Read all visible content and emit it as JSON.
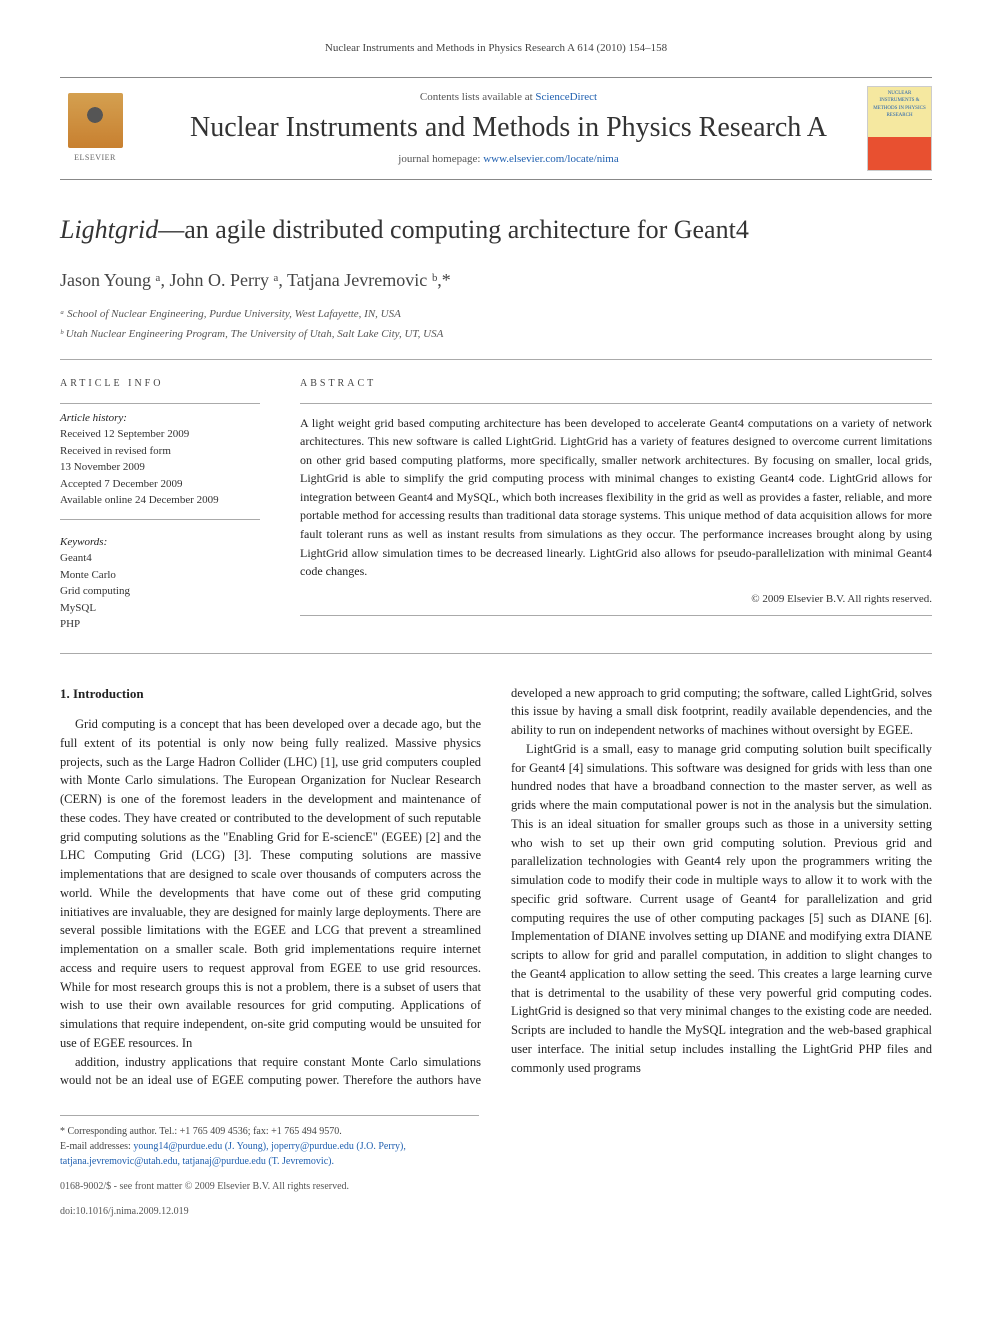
{
  "running_header": "Nuclear Instruments and Methods in Physics Research A 614 (2010) 154–158",
  "header": {
    "contents_prefix": "Contents lists available at ",
    "contents_link": "ScienceDirect",
    "journal_name": "Nuclear Instruments and Methods in Physics Research A",
    "homepage_prefix": "journal homepage: ",
    "homepage_link": "www.elsevier.com/locate/nima",
    "elsevier": "ELSEVIER",
    "cover_text": "NUCLEAR INSTRUMENTS & METHODS IN PHYSICS RESEARCH"
  },
  "title_italic": "Lightgrid",
  "title_rest": "—an agile distributed computing architecture for Geant4",
  "authors_line": "Jason Young ᵃ, John O. Perry ᵃ, Tatjana Jevremovic ᵇ,*",
  "affiliations": [
    "ᵃ School of Nuclear Engineering, Purdue University, West Lafayette, IN, USA",
    "ᵇ Utah Nuclear Engineering Program, The University of Utah, Salt Lake City, UT, USA"
  ],
  "info": {
    "label": "ARTICLE INFO",
    "history_label": "Article history:",
    "history": [
      "Received 12 September 2009",
      "Received in revised form",
      "13 November 2009",
      "Accepted 7 December 2009",
      "Available online 24 December 2009"
    ],
    "keywords_label": "Keywords:",
    "keywords": [
      "Geant4",
      "Monte Carlo",
      "Grid computing",
      "MySQL",
      "PHP"
    ]
  },
  "abstract": {
    "label": "ABSTRACT",
    "text": "A light weight grid based computing architecture has been developed to accelerate Geant4 computations on a variety of network architectures. This new software is called LightGrid. LightGrid has a variety of features designed to overcome current limitations on other grid based computing platforms, more specifically, smaller network architectures. By focusing on smaller, local grids, LightGrid is able to simplify the grid computing process with minimal changes to existing Geant4 code. LightGrid allows for integration between Geant4 and MySQL, which both increases flexibility in the grid as well as provides a faster, reliable, and more portable method for accessing results than traditional data storage systems. This unique method of data acquisition allows for more fault tolerant runs as well as instant results from simulations as they occur. The performance increases brought along by using LightGrid allow simulation times to be decreased linearly. LightGrid also allows for pseudo-parallelization with minimal Geant4 code changes.",
    "copyright": "© 2009 Elsevier B.V. All rights reserved."
  },
  "body": {
    "section_heading": "1.  Introduction",
    "col1_p1": "Grid computing is a concept that has been developed over a decade ago, but the full extent of its potential is only now being fully realized. Massive physics projects, such as the Large Hadron Collider (LHC) [1], use grid computers coupled with Monte Carlo simulations. The European Organization for Nuclear Research (CERN) is one of the foremost leaders in the development and maintenance of these codes. They have created or contributed to the development of such reputable grid computing solutions as the \"Enabling Grid for E-sciencE\" (EGEE) [2] and the LHC Computing Grid (LCG) [3]. These computing solutions are massive implementations that are designed to scale over thousands of computers across the world. While the developments that have come out of these grid computing initiatives are invaluable, they are designed for mainly large deployments. There are several possible limitations with the EGEE and LCG that prevent a streamlined implementation on a smaller scale. Both grid implementations require internet access and require users to request approval from EGEE to use grid resources. While for most research groups this is not a problem, there is a subset of users that wish to use their own available resources for grid computing. Applications of simulations that require independent, on-site grid computing would be unsuited for use of EGEE resources. In",
    "col2_p1": "addition, industry applications that require constant Monte Carlo simulations would not be an ideal use of EGEE computing power. Therefore the authors have developed a new approach to grid computing; the software, called LightGrid, solves this issue by having a small disk footprint, readily available dependencies, and the ability to run on independent networks of machines without oversight by EGEE.",
    "col2_p2": "LightGrid is a small, easy to manage grid computing solution built specifically for Geant4 [4] simulations. This software was designed for grids with less than one hundred nodes that have a broadband connection to the master server, as well as grids where the main computational power is not in the analysis but the simulation. This is an ideal situation for smaller groups such as those in a university setting who wish to set up their own grid computing solution. Previous grid and parallelization technologies with Geant4 rely upon the programmers writing the simulation code to modify their code in multiple ways to allow it to work with the specific grid software. Current usage of Geant4 for parallelization and grid computing requires the use of other computing packages [5] such as DIANE [6]. Implementation of DIANE involves setting up DIANE and modifying extra DIANE scripts to allow for grid and parallel computation, in addition to slight changes to the Geant4 application to allow setting the seed. This creates a large learning curve that is detrimental to the usability of these very powerful grid computing codes. LightGrid is designed so that very minimal changes to the existing code are needed. Scripts are included to handle the MySQL integration and the web-based graphical user interface. The initial setup includes installing the LightGrid PHP files and commonly used programs"
  },
  "footnote": {
    "corresponding": "* Corresponding author. Tel.: +1 765 409 4536; fax: +1 765 494 9570.",
    "email_label": "E-mail addresses: ",
    "emails": "young14@purdue.edu (J. Young), joperry@purdue.edu (J.O. Perry), tatjana.jevremovic@utah.edu, tatjanaj@purdue.edu (T. Jevremovic)."
  },
  "bottom": {
    "line1": "0168-9002/$ - see front matter © 2009 Elsevier B.V. All rights reserved.",
    "line2": "doi:10.1016/j.nima.2009.12.019"
  }
}
